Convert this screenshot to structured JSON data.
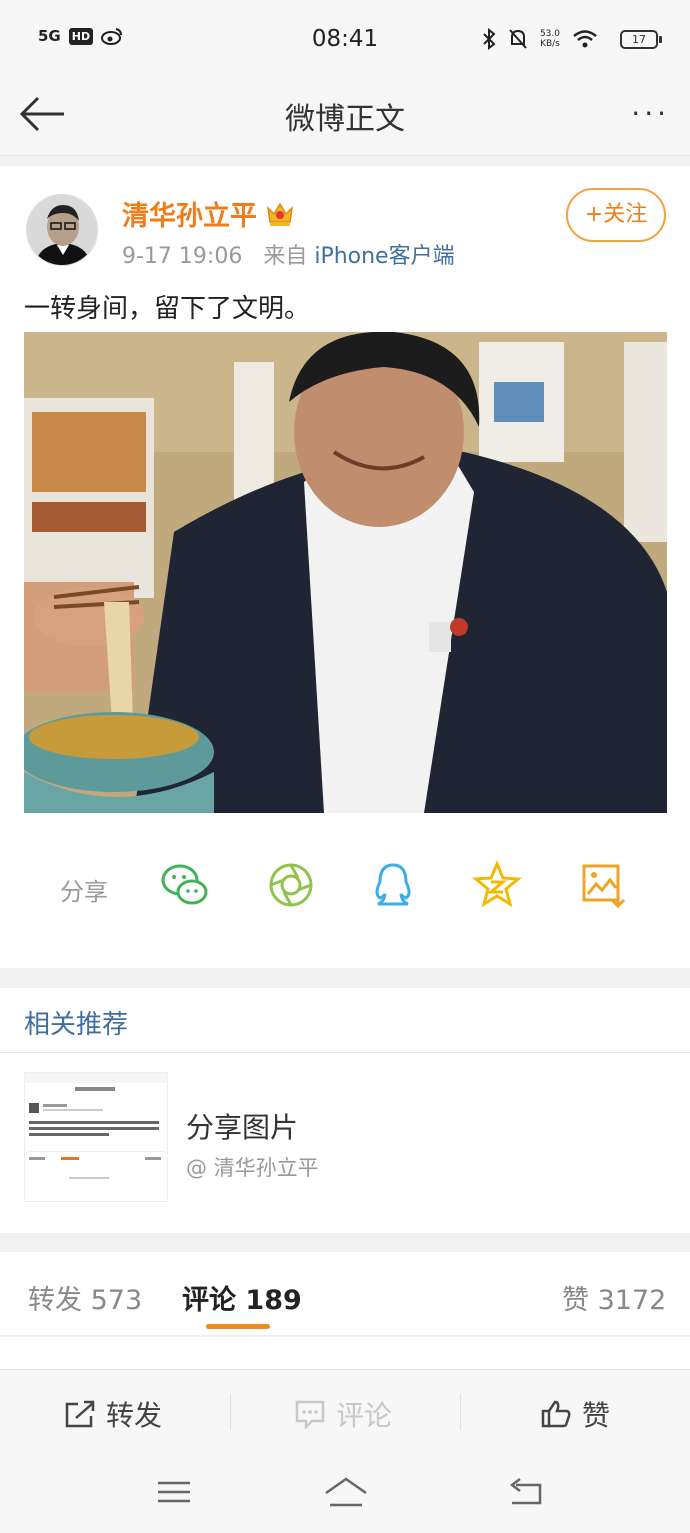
{
  "status_bar": {
    "network": "5G",
    "hd": "HD",
    "time": "08:41",
    "speed_value": "53.0",
    "speed_unit": "KB/s",
    "battery": "17"
  },
  "header": {
    "title": "微博正文",
    "back_icon": "arrow-left-icon",
    "more_icon": "more-dots-icon",
    "more_label": "···"
  },
  "post": {
    "author": "清华孙立平",
    "time": "9-17 19:06",
    "source_prefix": "来自",
    "source": "iPhone客户端",
    "follow_label": "+关注",
    "text": "一转身间，留下了文明。"
  },
  "share": {
    "label": "分享",
    "icons": [
      "wechat-icon",
      "moments-icon",
      "qq-icon",
      "qzone-icon",
      "save-image-icon"
    ]
  },
  "related": {
    "title": "相关推荐",
    "item": {
      "title": "分享图片",
      "author": "@ 清华孙立平"
    }
  },
  "tabs": [
    {
      "label": "转发",
      "count": "573"
    },
    {
      "label": "评论",
      "count": "189"
    },
    {
      "label": "赞",
      "count": "3172"
    }
  ],
  "actions": {
    "repost": "转发",
    "comment": "评论",
    "like": "赞"
  },
  "colors": {
    "accent": "#f07d1b",
    "link": "#3f6ea0",
    "wechat": "#3fb356",
    "moments": "#8fc34a",
    "qq": "#3aaee5",
    "qzone": "#f5b800",
    "save": "#f0a424"
  }
}
